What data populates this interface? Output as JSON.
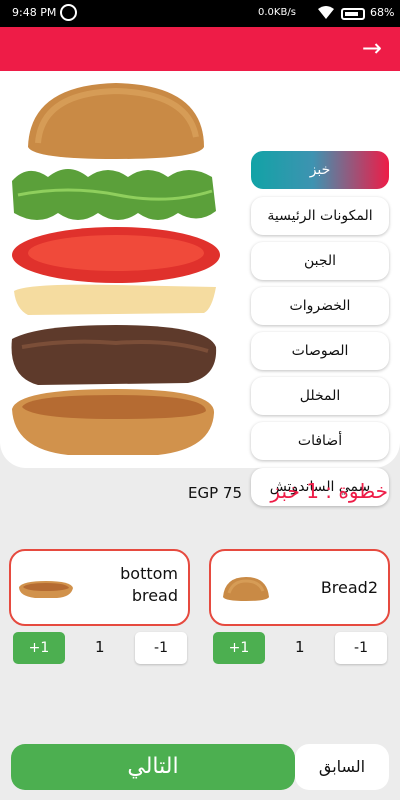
{
  "status_bar": {
    "time": "9:48 PM",
    "speed": "0.0KB/s",
    "battery": "68%"
  },
  "header": {
    "back_icon": "arrow-right-icon"
  },
  "categories": [
    {
      "label": "خبز",
      "active": true
    },
    {
      "label": "المكونات الرئيسية",
      "active": false
    },
    {
      "label": "الجبن",
      "active": false
    },
    {
      "label": "الخضروات",
      "active": false
    },
    {
      "label": "الصوصات",
      "active": false
    },
    {
      "label": "المخلل",
      "active": false
    },
    {
      "label": "أضافات",
      "active": false
    },
    {
      "label": "سمي الساندوتش",
      "active": false
    }
  ],
  "step": {
    "label": "خطوة : 1 خبز",
    "price": "EGP 75"
  },
  "options": [
    {
      "name": "Bread2",
      "quantity": "1",
      "plus_label": "+1",
      "minus_label": "-1"
    },
    {
      "name": "bottom bread",
      "quantity": "1",
      "plus_label": "+1",
      "minus_label": "-1"
    }
  ],
  "footer": {
    "next_label": "التالي",
    "prev_label": "السابق"
  },
  "colors": {
    "accent_red": "#ee1c47",
    "green": "#4caf50",
    "teal": "#11a3a6"
  }
}
